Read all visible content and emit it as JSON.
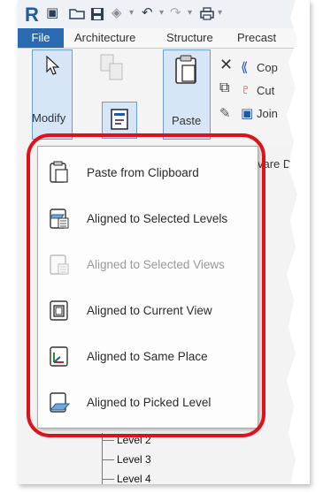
{
  "app": {
    "logo": "R"
  },
  "tabs": [
    {
      "label": "File"
    },
    {
      "label": "Architecture"
    },
    {
      "label": "Structure"
    },
    {
      "label": "Precast"
    }
  ],
  "ribbon": {
    "modify_label": "Modify",
    "paste_label": "Paste",
    "copy_label": "Cop",
    "cut_label": "Cut",
    "join_label": "Join",
    "dimension_label": "vare Dimensi"
  },
  "menu": {
    "items": [
      {
        "label": "Paste from Clipboard",
        "enabled": true,
        "icon": "paste-clipboard-icon"
      },
      {
        "label": "Aligned to Selected Levels",
        "enabled": true,
        "icon": "aligned-levels-icon"
      },
      {
        "label": "Aligned to Selected Views",
        "enabled": false,
        "icon": "aligned-views-icon"
      },
      {
        "label": "Aligned to Current View",
        "enabled": true,
        "icon": "aligned-current-view-icon"
      },
      {
        "label": "Aligned to Same Place",
        "enabled": true,
        "icon": "aligned-same-place-icon"
      },
      {
        "label": "Aligned to Picked Level",
        "enabled": true,
        "icon": "aligned-picked-level-icon"
      }
    ]
  },
  "tree": {
    "items": [
      {
        "label": "Level 2"
      },
      {
        "label": "Level 3"
      },
      {
        "label": "Level 4"
      }
    ]
  },
  "colors": {
    "highlight": "#e0111b",
    "file_tab": "#2a6ab1"
  }
}
